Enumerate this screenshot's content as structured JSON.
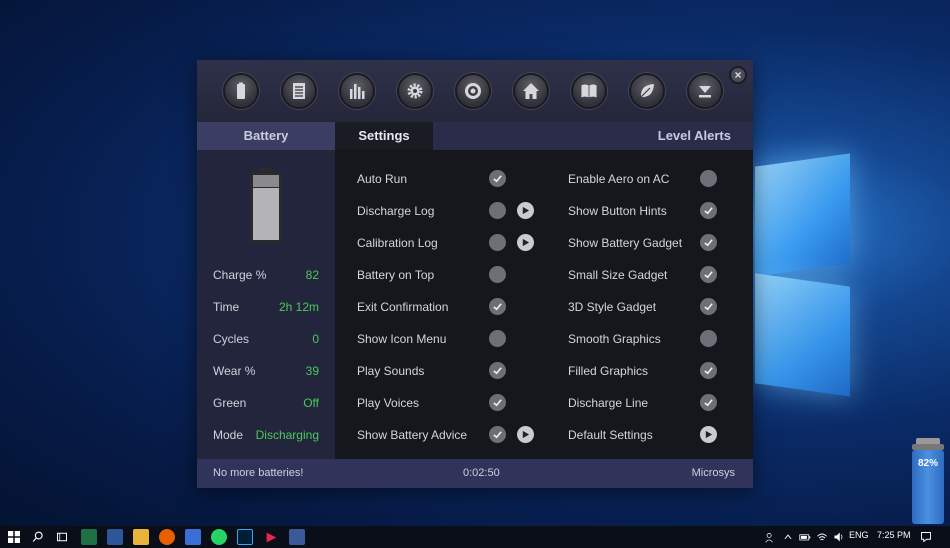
{
  "toolbar": {
    "icons": [
      "battery-icon",
      "list-icon",
      "bar-chart-icon",
      "gear-icon",
      "target-icon",
      "home-icon",
      "book-icon",
      "leaf-icon",
      "minimize-icon"
    ],
    "close_label": "×"
  },
  "tabs": {
    "battery": "Battery",
    "settings": "Settings",
    "alerts": "Level Alerts"
  },
  "stats": [
    {
      "label": "Charge %",
      "value": "82"
    },
    {
      "label": "Time",
      "value": "2h 12m"
    },
    {
      "label": "Cycles",
      "value": "0"
    },
    {
      "label": "Wear %",
      "value": "39"
    },
    {
      "label": "Green",
      "value": "Off"
    },
    {
      "label": "Mode",
      "value": "Discharging"
    }
  ],
  "settings_left": [
    {
      "label": "Auto Run",
      "checked": true,
      "play": false
    },
    {
      "label": "Discharge Log",
      "checked": false,
      "play": true
    },
    {
      "label": "Calibration Log",
      "checked": false,
      "play": true
    },
    {
      "label": "Battery on Top",
      "checked": false,
      "play": false
    },
    {
      "label": "Exit Confirmation",
      "checked": true,
      "play": false
    },
    {
      "label": "Show Icon Menu",
      "checked": false,
      "play": false
    },
    {
      "label": "Play Sounds",
      "checked": true,
      "play": false
    },
    {
      "label": "Play Voices",
      "checked": true,
      "play": false
    },
    {
      "label": "Show Battery Advice",
      "checked": true,
      "play": true
    }
  ],
  "settings_right": [
    {
      "label": "Enable Aero on AC",
      "checked": false
    },
    {
      "label": "Show Button Hints",
      "checked": true
    },
    {
      "label": "Show Battery Gadget",
      "checked": true
    },
    {
      "label": "Small Size Gadget",
      "checked": true
    },
    {
      "label": "3D Style Gadget",
      "checked": true
    },
    {
      "label": "Smooth Graphics",
      "checked": false
    },
    {
      "label": "Filled Graphics",
      "checked": true
    },
    {
      "label": "Discharge Line",
      "checked": true
    },
    {
      "label": "Default Settings",
      "checked": null,
      "play": true
    }
  ],
  "status": {
    "left": "No more batteries!",
    "center": "0:02:50",
    "right": "Microsys"
  },
  "gadget": {
    "label": "82%"
  },
  "taskbar": {
    "lang": "ENG",
    "time": "7:25 PM"
  },
  "colors": {
    "accent_green": "#4cc95a",
    "tab_bar": "#2a2c4a",
    "panel_left": "#23253c",
    "panel_right": "#15171d"
  }
}
